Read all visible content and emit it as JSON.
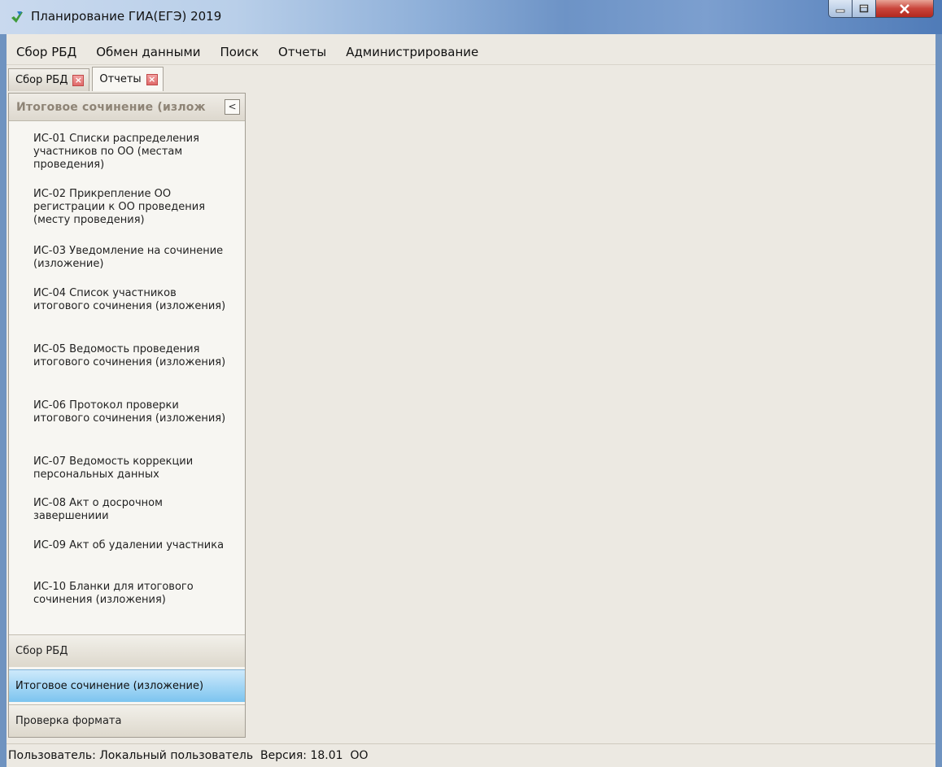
{
  "window": {
    "title": "Планирование ГИА(ЕГЭ) 2019"
  },
  "menu": [
    "Сбор РБД",
    "Обмен данными",
    "Поиск",
    "Отчеты",
    "Администрирование"
  ],
  "tabs": [
    {
      "label": "Сбор РБД",
      "active": false
    },
    {
      "label": "Отчеты",
      "active": true
    }
  ],
  "panel": {
    "header": "Итоговое сочинение (излож",
    "collapse_glyph": "<",
    "reports": [
      "ИС-01 Списки распределения участников по ОО (местам проведения)",
      "ИС-02 Прикрепление ОО регистрации к ОО проведения (месту проведения)",
      "ИС-03 Уведомление на сочинение (изложение)",
      "ИС-04 Список участников итогового сочинения (изложения)",
      "ИС-05 Ведомость проведения итогового сочинения (изложения)",
      "ИС-06 Протокол проверки итогового сочинения (изложения)",
      "ИС-07 Ведомость коррекции персональных данных",
      "ИС-08 Акт о досрочном завершениии",
      "ИС-09 Акт об удалении участника",
      "ИС-10 Бланки для итогового сочинения (изложения)"
    ],
    "nav": [
      {
        "label": "Сбор РБД",
        "active": false
      },
      {
        "label": "Итоговое сочинение (изложение)",
        "active": true
      },
      {
        "label": "Проверка формата",
        "active": false
      }
    ]
  },
  "status": {
    "text": "Пользователь: Локальный пользователь  Версия: 18.01  ОО"
  },
  "colors": {
    "accent": "#7cc4ef",
    "frame": "#6f93c0",
    "close": "#c9453b"
  },
  "icons": {
    "app": "app-logo-icon",
    "minimize": "minimize-icon",
    "maximize": "maximize-icon",
    "close": "close-icon",
    "tab_close": "tab-close-icon",
    "collapse": "chevron-left-icon"
  }
}
